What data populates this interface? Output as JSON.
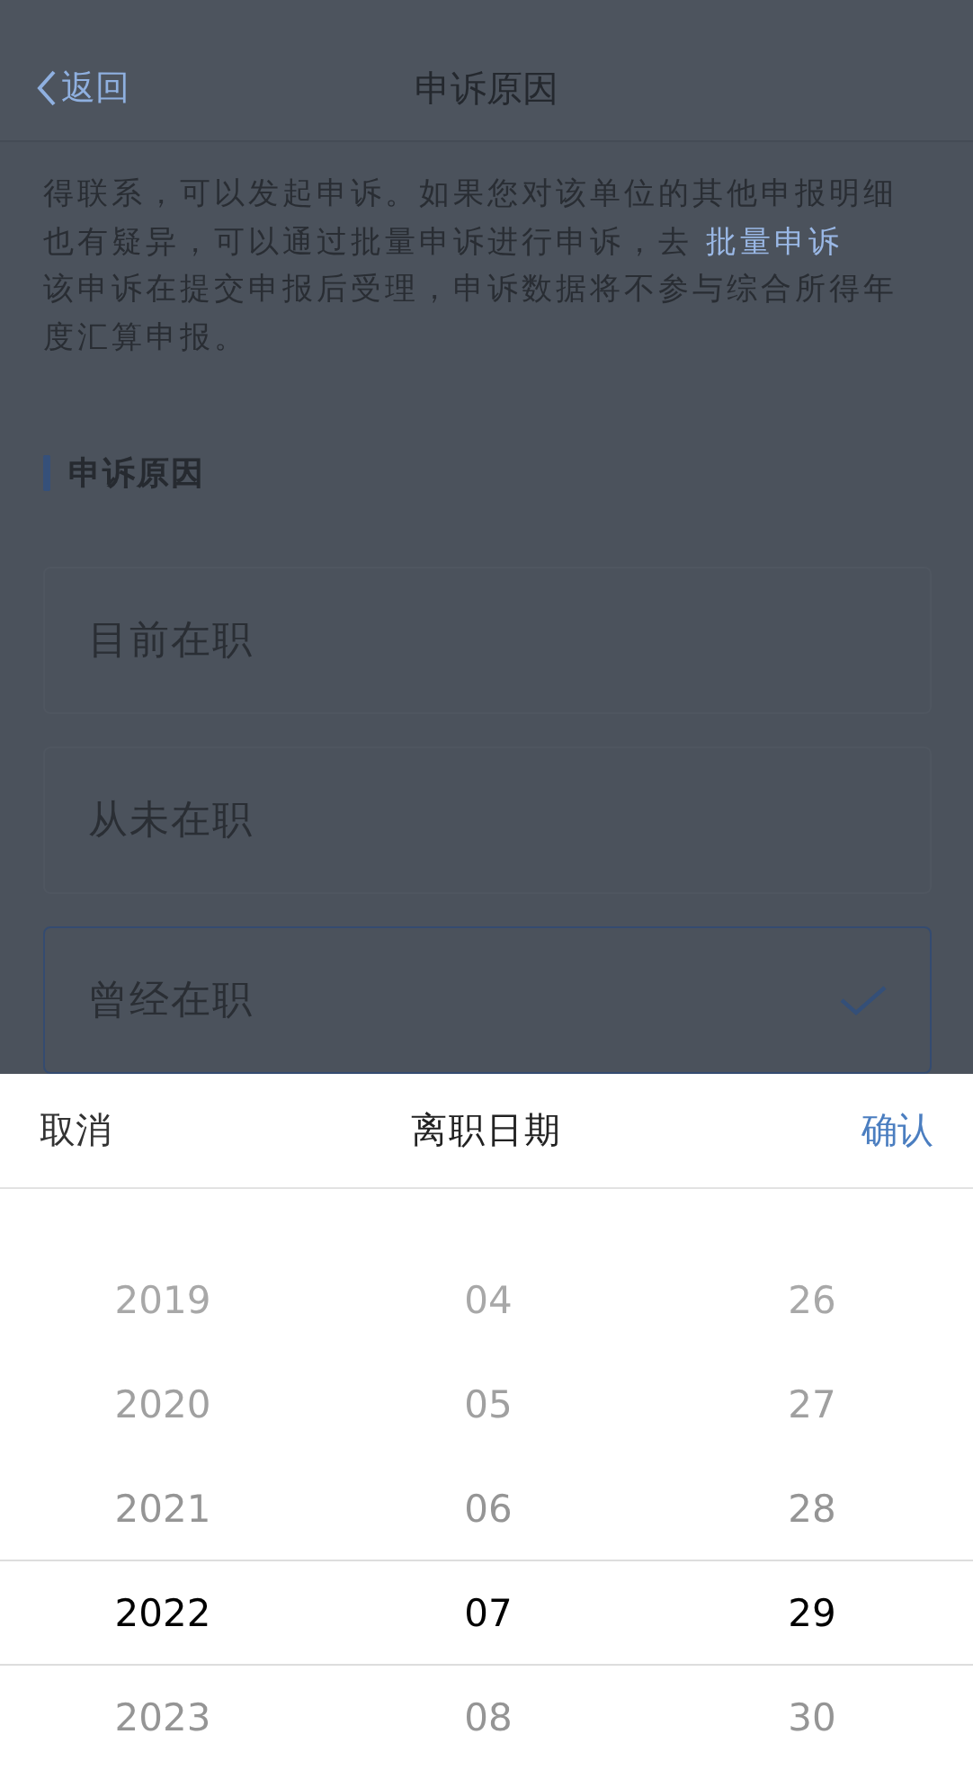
{
  "nav": {
    "back": "返回",
    "title": "申诉原因"
  },
  "notice": {
    "text": "得联系，可以发起申诉。如果您对该单位的其他申报明细也有疑异，可以通过批量申诉进行申诉，去 ",
    "link": "批量申诉",
    "text_2": "该申诉在提交申报后受理，申诉数据将不参与综合所得年度汇算申报。"
  },
  "section_title": "申诉原因",
  "reasons": [
    {
      "label": "目前在职",
      "selected": false
    },
    {
      "label": "从未在职",
      "selected": false
    },
    {
      "label": "曾经在职",
      "selected": true
    }
  ],
  "picker": {
    "cancel": "取消",
    "title": "离职日期",
    "confirm": "确认",
    "columns": [
      {
        "items": [
          {
            "label": "2019",
            "selected": false
          },
          {
            "label": "2020",
            "selected": false
          },
          {
            "label": "2021",
            "selected": false
          },
          {
            "label": "2022",
            "selected": true
          },
          {
            "label": "2023",
            "selected": false
          }
        ]
      },
      {
        "items": [
          {
            "label": "04",
            "selected": false
          },
          {
            "label": "05",
            "selected": false
          },
          {
            "label": "06",
            "selected": false
          },
          {
            "label": "07",
            "selected": true
          },
          {
            "label": "08",
            "selected": false
          }
        ]
      },
      {
        "items": [
          {
            "label": "26",
            "selected": false
          },
          {
            "label": "27",
            "selected": false
          },
          {
            "label": "28",
            "selected": false
          },
          {
            "label": "29",
            "selected": true
          },
          {
            "label": "30",
            "selected": false
          }
        ]
      }
    ]
  }
}
